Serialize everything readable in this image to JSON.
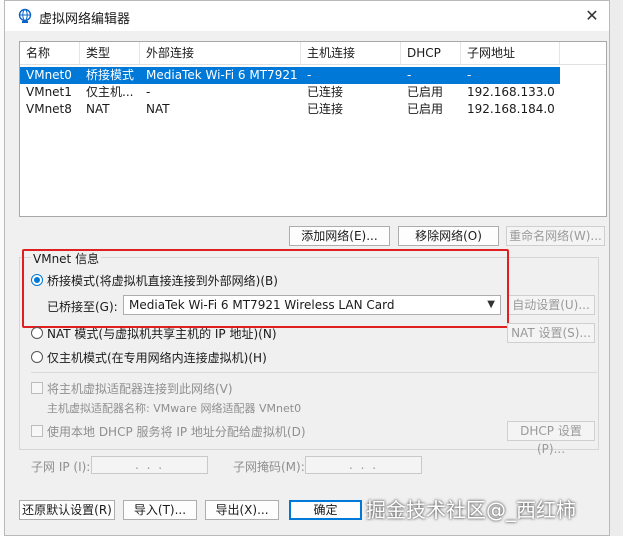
{
  "window": {
    "title": "虚拟网络编辑器",
    "close_glyph": "✕"
  },
  "table": {
    "headers": [
      "名称",
      "类型",
      "外部连接",
      "主机连接",
      "DHCP",
      "子网地址"
    ],
    "rows": [
      {
        "name": "VMnet0",
        "type": "桥接模式",
        "external": "MediaTek Wi-Fi 6 MT7921 W...",
        "host": "-",
        "dhcp": "-",
        "subnet": "-",
        "selected": true
      },
      {
        "name": "VMnet1",
        "type": "仅主机...",
        "external": "-",
        "host": "已连接",
        "dhcp": "已启用",
        "subnet": "192.168.133.0",
        "selected": false
      },
      {
        "name": "VMnet8",
        "type": "NAT",
        "external": "NAT",
        "host": "已连接",
        "dhcp": "已启用",
        "subnet": "192.168.184.0",
        "selected": false
      }
    ]
  },
  "table_buttons": {
    "add": "添加网络(E)...",
    "remove": "移除网络(O)",
    "rename": "重命名网络(W)..."
  },
  "vmnet_info": {
    "title": "VMnet 信息",
    "bridged": "桥接模式(将虚拟机直接连接到外部网络)(B)",
    "bridged_to_label": "已桥接至(G):",
    "bridged_to_value": "MediaTek Wi-Fi 6 MT7921 Wireless LAN Card",
    "auto_settings": "自动设置(U)...",
    "nat": "NAT 模式(与虚拟机共享主机的 IP 地址)(N)",
    "nat_settings": "NAT 设置(S)...",
    "host_only": "仅主机模式(在专用网络内连接虚拟机)(H)",
    "connect_adapter": "将主机虚拟适配器连接到此网络(V)",
    "adapter_name": "主机虚拟适配器名称: VMware 网络适配器 VMnet0",
    "use_dhcp": "使用本地 DHCP 服务将 IP 地址分配给虚拟机(D)",
    "dhcp_settings": "DHCP 设置(P)...",
    "subnet_ip_label": "子网 IP (I):",
    "subnet_ip_value": ". . .",
    "subnet_mask_label": "子网掩码(M):",
    "subnet_mask_value": ". . ."
  },
  "footer_buttons": {
    "restore": "还原默认设置(R)",
    "import": "导入(T)...",
    "export": "导出(X)...",
    "ok": "确定"
  },
  "watermark": "掘金技术社区@_西红柿",
  "colors": {
    "selection": "#0078d7",
    "highlight": "#e02020"
  }
}
